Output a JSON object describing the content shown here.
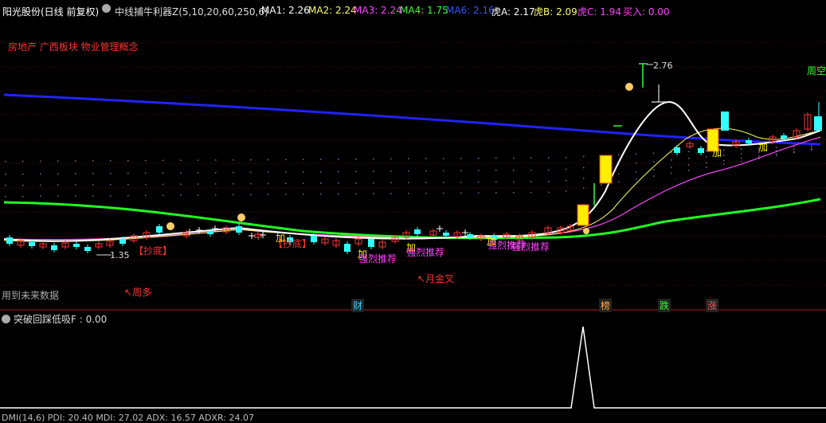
{
  "header": {
    "stock_title": "阳光股份(日线 前复权)",
    "indicator_name": "中线捕牛利器Z(5,10,20,60,250,6)",
    "ma_values": [
      {
        "label": "MA1: 2.26",
        "color": "#ffffff"
      },
      {
        "label": "MA2: 2.24",
        "color": "#ffff66"
      },
      {
        "label": "MA3: 2.24",
        "color": "#ff44ff"
      },
      {
        "label": "MA4: 1.75",
        "color": "#33ff33"
      },
      {
        "label": "MA6: 2.16",
        "color": "#3355ff"
      },
      {
        "label": "虎A: 2.17",
        "color": "#ffffff"
      },
      {
        "label": "虎B: 2.09",
        "color": "#ffff66"
      },
      {
        "label": "虎C: 1.94",
        "color": "#ff44ff"
      },
      {
        "label": "买入: 0.00",
        "color": "#ff44ff"
      }
    ]
  },
  "sector_tags": "房地产 广西板块 物业管理概念",
  "future_note": "用到未来数据",
  "annotations": {
    "high_price": "2.76",
    "low_price": "1.35",
    "week_empty": "周空",
    "week_many": "周多",
    "month_golden_cross": "月金叉",
    "bottom_fishing_1": "【抄底】",
    "bottom_fishing_2": "【抄底】",
    "add_1": "加",
    "add_2": "加",
    "add_3": "加",
    "add_4": "加",
    "add_5": "加",
    "add_6": "加",
    "strong_rec_1": "强烈推荐",
    "strong_rec_2": "强烈推荐",
    "strong_rec_3": "强烈推荐",
    "strong_rec_4": "强烈推荐"
  },
  "event_markers": [
    {
      "label": "财",
      "color": "#33ccff"
    },
    {
      "label": "榜",
      "color": "#ffaa44"
    },
    {
      "label": "跌",
      "color": "#33ff33"
    },
    {
      "label": "涨",
      "color": "#ff5555"
    }
  ],
  "sub_panel": {
    "title": "突破回踩低吸F : 0.00",
    "bottom_line": "DMI(14,6) PDI: 20.40 MDI: 27.02 ADX: 16.57 ADXR: 24.07"
  },
  "colors": {
    "up": "#ff3333",
    "down": "#33ffff",
    "yang_fill": "#ffee00",
    "ma_white": "#ffffff",
    "ma_yellow": "#ffff66",
    "ma_magenta": "#ff44ff",
    "ma_green": "#33ff33",
    "ma_blue": "#2222ff"
  },
  "icons": [
    "circle-arrow-down-icon",
    "up-arrow-icon",
    "candlestick-icon"
  ]
}
